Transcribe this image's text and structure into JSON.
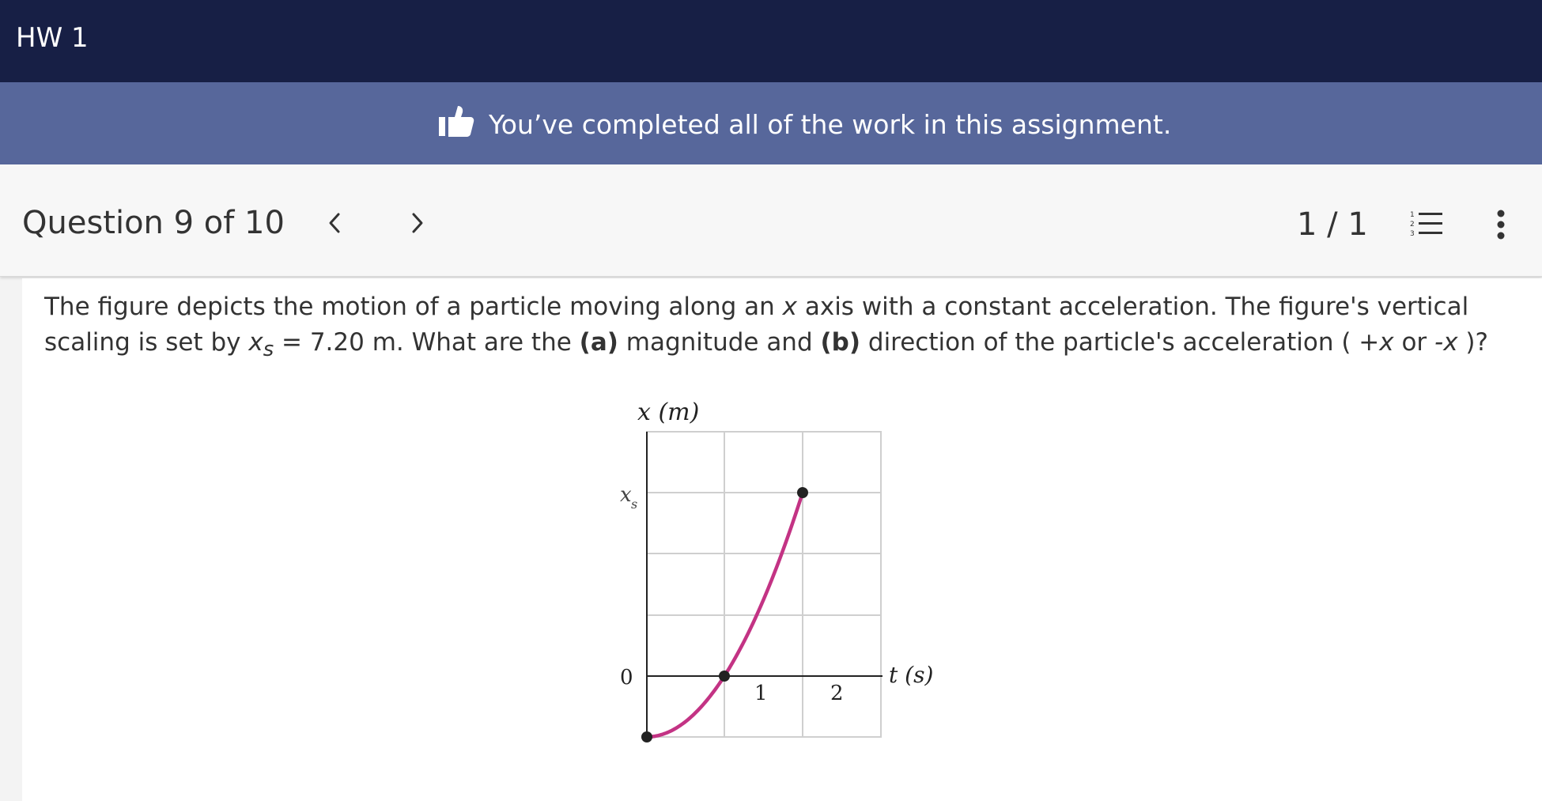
{
  "header": {
    "title": "HW 1"
  },
  "banner": {
    "message": "You’ve completed all of the work in this assignment."
  },
  "question_bar": {
    "label": "Question 9 of 10",
    "counter": "1 / 1"
  },
  "question": {
    "part1": "The figure depicts the motion of a particle moving along an ",
    "var_x": "x",
    "part2": " axis with a constant acceleration. The figure's vertical scaling is set by ",
    "var_xs": "x",
    "sub_s": "s",
    "part3": " = 7.20 m. What are the ",
    "a_label": "(a)",
    "part4": " magnitude and ",
    "b_label": "(b)",
    "part5": " direction of the particle's acceleration ( ",
    "plus_x": "+x",
    "part6": " or ",
    "minus_x": "-x",
    "part7": " )?"
  },
  "figure": {
    "y_axis_label": "x (m)",
    "x_axis_label": "t (s)",
    "tick_xs_letter": "x",
    "tick_xs_sub": "s",
    "tick_zero": "0",
    "tick_1": "1",
    "tick_2": "2",
    "curve_color": "#c33384"
  }
}
